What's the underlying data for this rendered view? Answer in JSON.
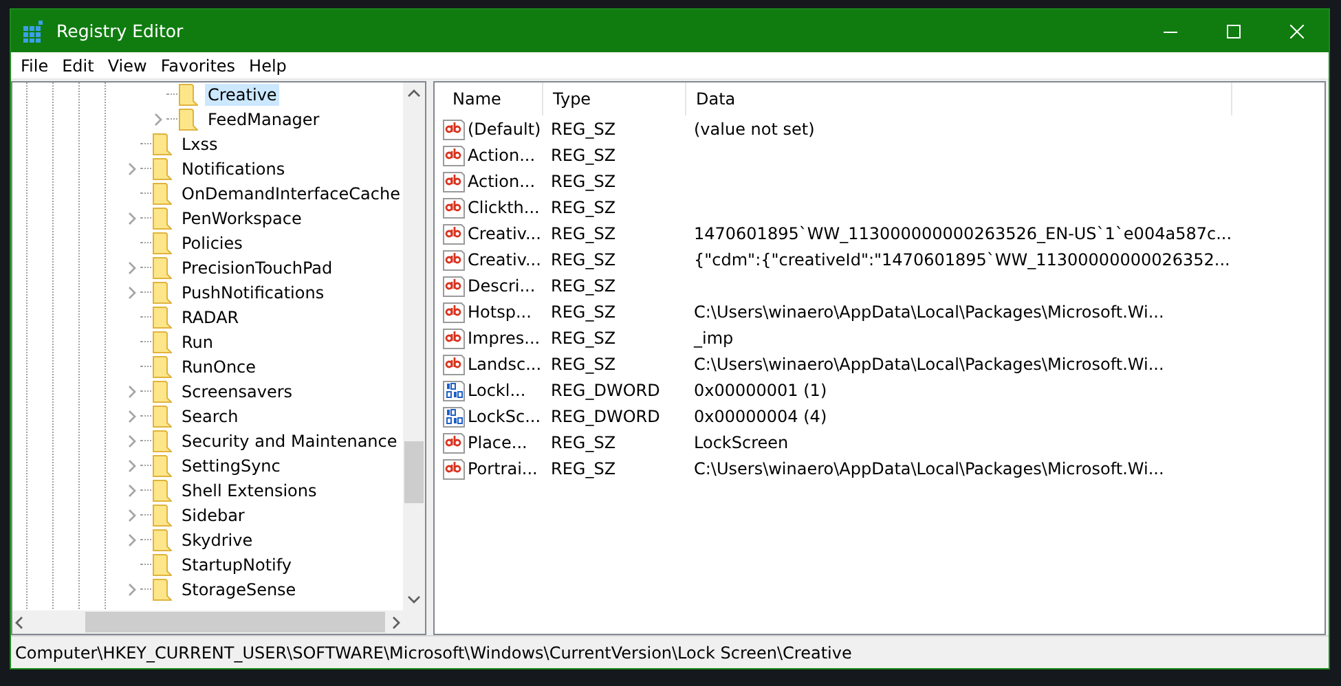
{
  "window": {
    "title": "Registry Editor"
  },
  "menu": [
    "File",
    "Edit",
    "View",
    "Favorites",
    "Help"
  ],
  "tree": {
    "continued_children": [
      {
        "label": "Creative",
        "expandable": false,
        "selected": true
      },
      {
        "label": "FeedManager",
        "expandable": true,
        "selected": false
      }
    ],
    "items": [
      {
        "label": "Lxss",
        "expandable": false,
        "selected": false
      },
      {
        "label": "Notifications",
        "expandable": true,
        "selected": false
      },
      {
        "label": "OnDemandInterfaceCache",
        "expandable": false,
        "selected": false
      },
      {
        "label": "PenWorkspace",
        "expandable": true,
        "selected": false
      },
      {
        "label": "Policies",
        "expandable": false,
        "selected": false
      },
      {
        "label": "PrecisionTouchPad",
        "expandable": true,
        "selected": false
      },
      {
        "label": "PushNotifications",
        "expandable": true,
        "selected": false
      },
      {
        "label": "RADAR",
        "expandable": false,
        "selected": false
      },
      {
        "label": "Run",
        "expandable": false,
        "selected": false
      },
      {
        "label": "RunOnce",
        "expandable": false,
        "selected": false
      },
      {
        "label": "Screensavers",
        "expandable": true,
        "selected": false
      },
      {
        "label": "Search",
        "expandable": true,
        "selected": false
      },
      {
        "label": "Security and Maintenance",
        "expandable": true,
        "selected": false
      },
      {
        "label": "SettingSync",
        "expandable": true,
        "selected": false
      },
      {
        "label": "Shell Extensions",
        "expandable": true,
        "selected": false
      },
      {
        "label": "Sidebar",
        "expandable": true,
        "selected": false
      },
      {
        "label": "Skydrive",
        "expandable": true,
        "selected": false
      },
      {
        "label": "StartupNotify",
        "expandable": false,
        "selected": false
      },
      {
        "label": "StorageSense",
        "expandable": true,
        "selected": false
      }
    ]
  },
  "table": {
    "columns": [
      "Name",
      "Type",
      "Data"
    ],
    "rows": [
      {
        "kind": "string",
        "name": "(Default)",
        "type": "REG_SZ",
        "data": "(value not set)"
      },
      {
        "kind": "string",
        "name": "Action...",
        "type": "REG_SZ"
      },
      {
        "kind": "string",
        "name": "Action...",
        "type": "REG_SZ"
      },
      {
        "kind": "string",
        "name": "Clickth...",
        "type": "REG_SZ"
      },
      {
        "kind": "string",
        "name": "Creativ...",
        "type": "REG_SZ",
        "data": "1470601895`WW_113000000000263526_EN-US`1`e004a587c..."
      },
      {
        "kind": "string",
        "name": "Creativ...",
        "type": "REG_SZ",
        "data": "{\"cdm\":{\"creativeId\":\"1470601895`WW_11300000000026352..."
      },
      {
        "kind": "string",
        "name": "Descri...",
        "type": "REG_SZ"
      },
      {
        "kind": "string",
        "name": "Hotsp...",
        "type": "REG_SZ",
        "data": "C:\\Users\\winaero\\AppData\\Local\\Packages\\Microsoft.Wi..."
      },
      {
        "kind": "string",
        "name": "Impres...",
        "type": "REG_SZ",
        "data": "_imp"
      },
      {
        "kind": "string",
        "name": "Landsc...",
        "type": "REG_SZ",
        "data": "C:\\Users\\winaero\\AppData\\Local\\Packages\\Microsoft.Wi..."
      },
      {
        "kind": "binary",
        "name": "Lockl...",
        "type": "REG_DWORD",
        "data": "0x00000001 (1)"
      },
      {
        "kind": "binary",
        "name": "LockSc...",
        "type": "REG_DWORD",
        "data": "0x00000004 (4)"
      },
      {
        "kind": "string",
        "name": "Place...",
        "type": "REG_SZ",
        "data": "LockScreen"
      },
      {
        "kind": "string",
        "name": "Portrai...",
        "type": "REG_SZ",
        "data": "C:\\Users\\winaero\\AppData\\Local\\Packages\\Microsoft.Wi..."
      }
    ]
  },
  "status_bar": "Computer\\HKEY_CURRENT_USER\\SOFTWARE\\Microsoft\\Windows\\CurrentVersion\\Lock Screen\\Creative"
}
